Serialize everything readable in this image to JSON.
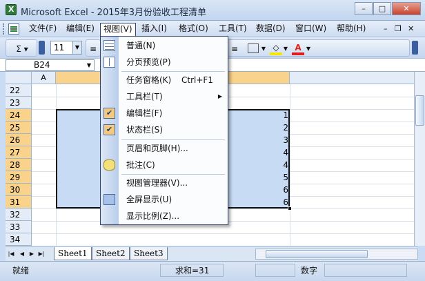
{
  "window": {
    "title": "Microsoft Excel - 2015年3月份验收工程清单",
    "btn_min": "–",
    "btn_max": "□",
    "btn_close": "✕"
  },
  "menubar": {
    "items": [
      "文件(F)",
      "编辑(E)",
      "视图(V)",
      "插入(I)",
      "格式(O)",
      "工具(T)",
      "数据(D)",
      "窗口(W)",
      "帮助(H)"
    ],
    "open_item": "视图(V)",
    "mdi_min": "–",
    "mdi_restore": "❐",
    "mdi_close": "✕"
  },
  "toolbar": {
    "sum_label": "Σ ▾",
    "font_size": "11",
    "font_color_label": "A"
  },
  "namebox": {
    "value": "B24"
  },
  "grid": {
    "col_a": "A",
    "rows": [
      "22",
      "23",
      "24",
      "25",
      "26",
      "27",
      "28",
      "29",
      "30",
      "31",
      "32",
      "33",
      "34"
    ],
    "values": [
      "1",
      "2",
      "3",
      "4",
      "4",
      "5",
      "6",
      "6"
    ]
  },
  "sheets": [
    "Sheet1",
    "Sheet2",
    "Sheet3"
  ],
  "status": {
    "ready": "就绪",
    "sum": "求和=31",
    "mode": "数字"
  },
  "view_menu": {
    "normal": "普通(N)",
    "page_break": "分页预览(P)",
    "task_pane": "任务窗格(K)",
    "task_pane_shortcut": "Ctrl+F1",
    "toolbars": "工具栏(T)",
    "formula_bar": "编辑栏(F)",
    "status_bar": "状态栏(S)",
    "header_footer": "页眉和页脚(H)...",
    "comments": "批注(C)",
    "custom_views": "视图管理器(V)...",
    "full_screen": "全屏显示(U)",
    "zoom": "显示比例(Z)..."
  }
}
